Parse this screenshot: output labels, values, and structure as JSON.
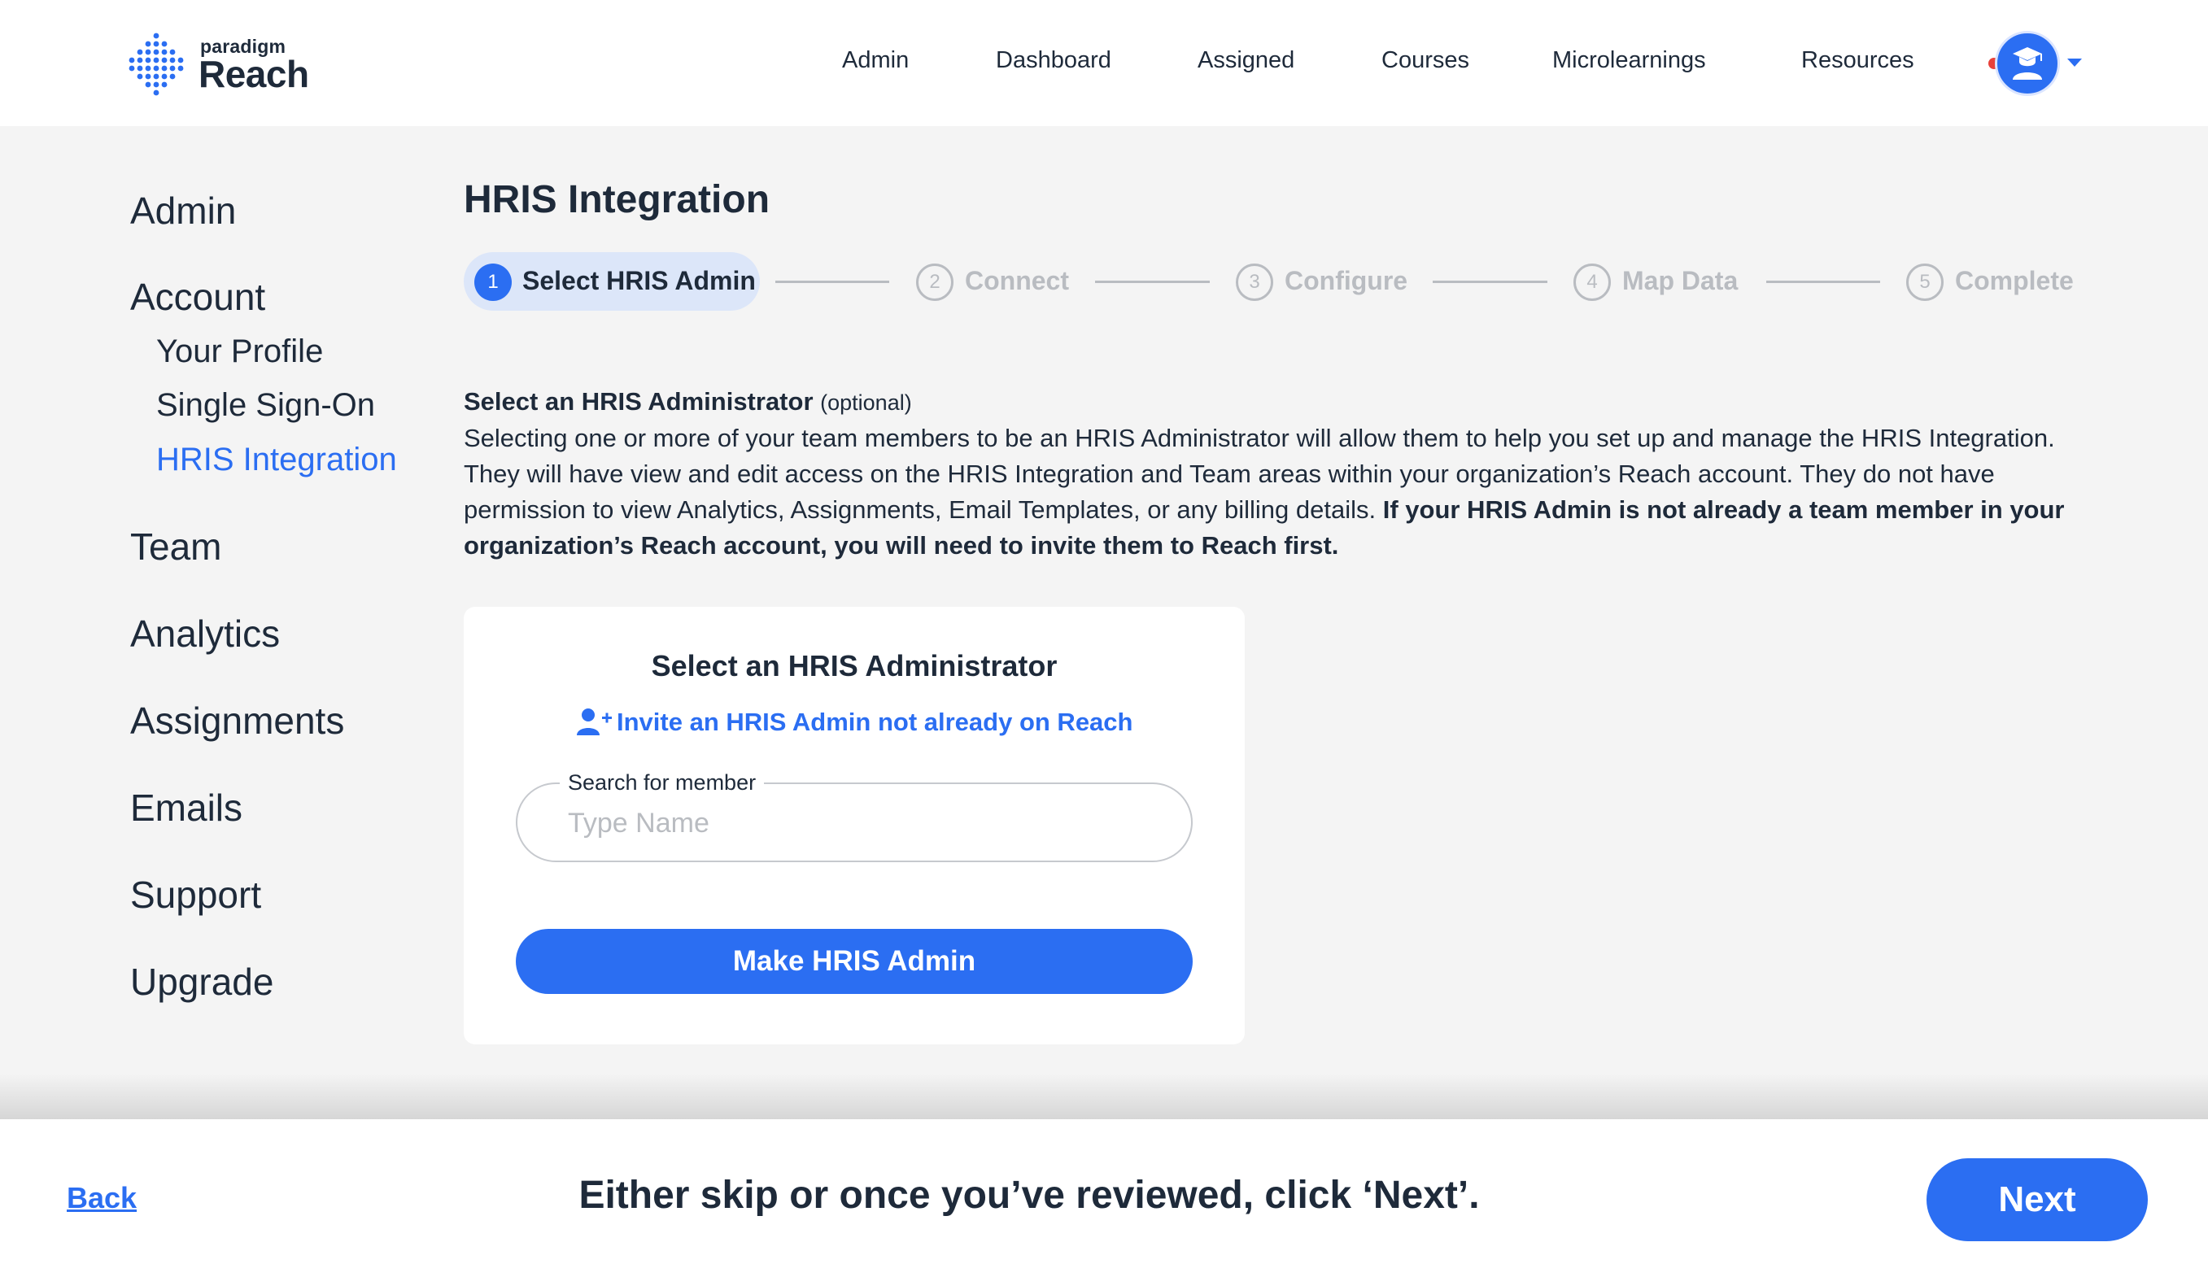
{
  "brand": {
    "small": "paradigm",
    "big": "Reach"
  },
  "nav": {
    "items": [
      "Admin",
      "Dashboard",
      "Assigned",
      "Courses",
      "Microlearnings",
      "Resources"
    ]
  },
  "sidebar": {
    "admin": "Admin",
    "account": "Account",
    "account_items": [
      "Your Profile",
      "Single Sign-On",
      "HRIS Integration"
    ],
    "team": "Team",
    "analytics": "Analytics",
    "assignments": "Assignments",
    "emails": "Emails",
    "support": "Support",
    "upgrade": "Upgrade"
  },
  "main": {
    "title": "HRIS Integration",
    "steps": [
      {
        "num": "1",
        "label": "Select HRIS Admin",
        "active": true
      },
      {
        "num": "2",
        "label": "Connect",
        "active": false
      },
      {
        "num": "3",
        "label": "Configure",
        "active": false
      },
      {
        "num": "4",
        "label": "Map Data",
        "active": false
      },
      {
        "num": "5",
        "label": "Complete",
        "active": false
      }
    ],
    "desc_heading": "Select an HRIS Administrator",
    "desc_optional": "(optional)",
    "desc_body": "Selecting one or more of your team members to be an HRIS Administrator will allow them to help you set up and manage the HRIS Integration. They will have view and edit access on the HRIS Integration and Team areas within your organization’s Reach account. They do not have permission to view Analytics, Assignments, Email Templates, or any billing details.",
    "desc_bold": "If your HRIS Admin is not already a team member in your organization’s Reach account, you will need to invite them to Reach first.",
    "card": {
      "title": "Select an HRIS Administrator",
      "invite_link": "Invite an HRIS Admin not already on Reach",
      "search_label": "Search for member",
      "search_placeholder": "Type Name",
      "search_value": "",
      "submit": "Make HRIS Admin"
    }
  },
  "footer": {
    "back": "Back",
    "message": "Either skip or once you’ve reviewed, click ‘Next’.",
    "next": "Next"
  },
  "colors": {
    "accent": "#2b6ef2",
    "text": "#1e2a3a",
    "muted": "#b9bcc1",
    "background": "#f4f4f4",
    "notification": "#e8413a"
  },
  "icons": [
    "reach-logo-icon",
    "graduate-avatar-icon",
    "chevron-down-icon",
    "add-user-icon"
  ]
}
